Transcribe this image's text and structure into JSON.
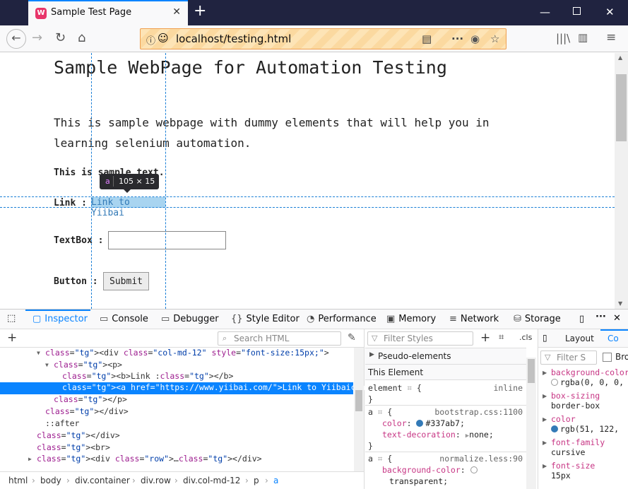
{
  "browser": {
    "tab_title": "Sample Test Page",
    "url": "localhost/testing.html",
    "nav_icons": [
      "back-icon",
      "forward-icon",
      "reload-icon",
      "home-icon"
    ]
  },
  "page": {
    "heading": "Sample WebPage for Automation Testing",
    "intro": "This is sample webpage with dummy elements that will help you in learning selenium automation.",
    "sample_text": "This is sample text.",
    "link_label": "Link :",
    "link_text": "Link to Yiibai",
    "textbox_label": "TextBox :",
    "button_label": "Button :",
    "submit_text": "Submit",
    "tooltip_tag": "a",
    "tooltip_dims": "105 × 15"
  },
  "devtools": {
    "tabs": [
      "Inspector",
      "Console",
      "Debugger",
      "Style Editor",
      "Performance",
      "Memory",
      "Network",
      "Storage"
    ],
    "search_placeholder": "Search HTML",
    "markup": [
      {
        "indent": 5,
        "html": "&lt;div class=\"col-md-12\" style=\"font-size:15px;\"&gt;"
      },
      {
        "indent": 6,
        "html": "&lt;p&gt;"
      },
      {
        "indent": 7,
        "html": "&lt;b&gt;Link :&lt;/b&gt;"
      },
      {
        "indent": 7,
        "html": "&lt;a href=\"https://www.yiibai.com/\"&gt;Link to Yiibai&lt;/a&gt;"
      },
      {
        "indent": 6,
        "html": "&lt;/p&gt;"
      },
      {
        "indent": 5,
        "html": "&lt;/div&gt;"
      },
      {
        "indent": 5,
        "html": "::after"
      },
      {
        "indent": 4,
        "html": "&lt;/div&gt;"
      },
      {
        "indent": 4,
        "html": "&lt;br&gt;"
      },
      {
        "indent": 4,
        "html": "&lt;div class=\"row\"&gt;…&lt;/div&gt;"
      }
    ],
    "breadcrumbs": [
      "html",
      "body",
      "div.container",
      "div.row",
      "div.col-md-12",
      "p",
      "a"
    ],
    "filter_styles_placeholder": "Filter Styles",
    "cls_label": ".cls",
    "pseudo_elements": "Pseudo-elements",
    "this_element": "This Element",
    "rules": {
      "element_selector": "element",
      "element_src": "inline",
      "bootstrap_src": "bootstrap.css:1100",
      "color_prop": "color",
      "color_val": "#337ab7",
      "text_dec_prop": "text-decoration",
      "text_dec_val": "none",
      "normalize_src": "normalize.less:90",
      "bg_prop": "background-color",
      "bg_val": "transparent",
      "a_selector": "a"
    },
    "computed_tabs": [
      "Layout",
      "Co"
    ],
    "computed_filter": "Filter S",
    "computed_checkbox_label": "Bro",
    "computed": [
      {
        "prop": "background-color",
        "val": "rgba(0, 0, 0,"
      },
      {
        "prop": "box-sizing",
        "val": "border-box"
      },
      {
        "prop": "color",
        "val": "rgb(51, 122,"
      },
      {
        "prop": "font-family",
        "val": "cursive"
      },
      {
        "prop": "font-size",
        "val": "15px"
      }
    ]
  },
  "colors": {
    "link": "#337ab7",
    "accent": "#0a84ff"
  }
}
